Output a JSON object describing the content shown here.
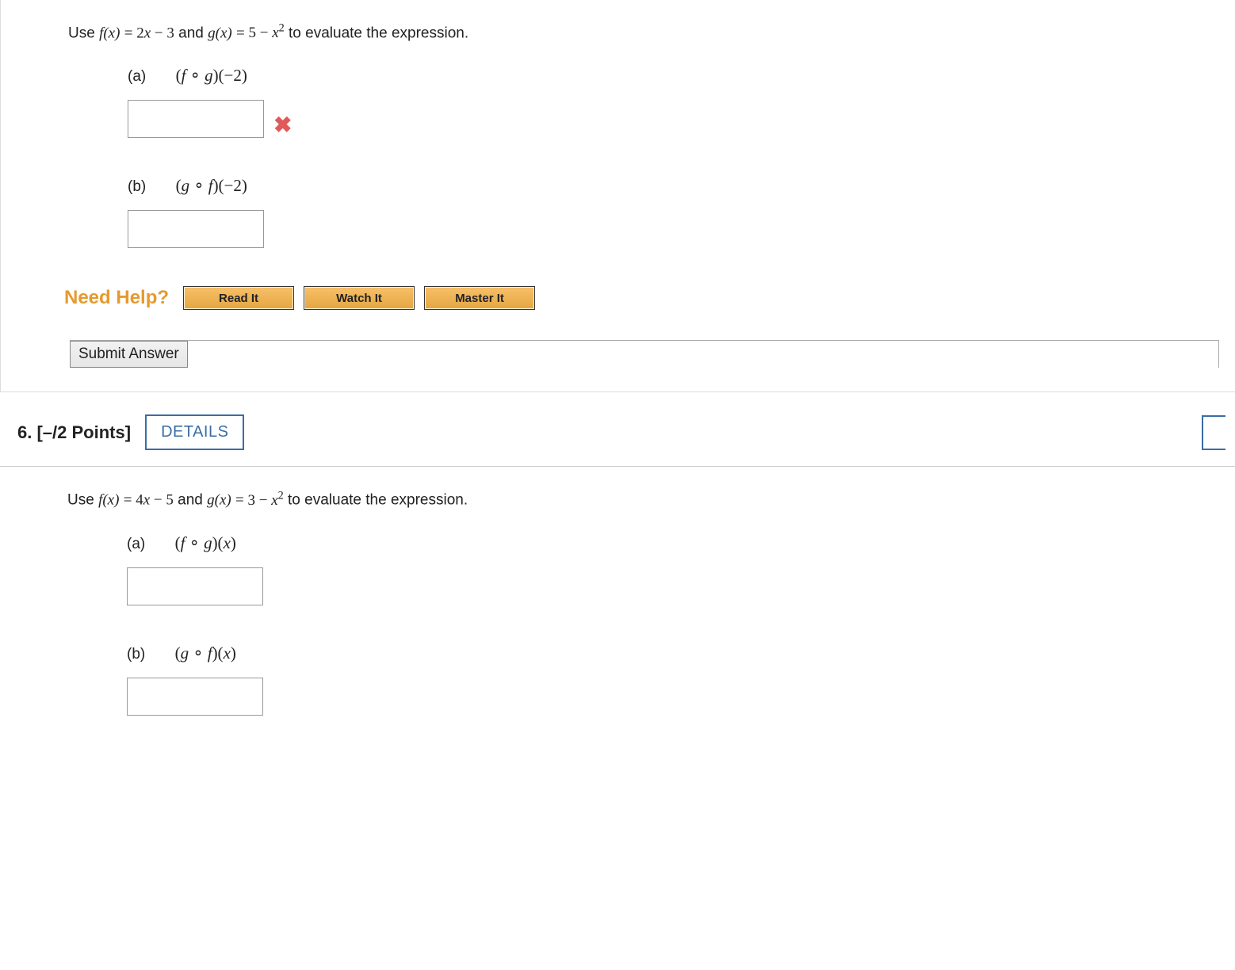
{
  "q5": {
    "prompt_pre": "Use  ",
    "f_def_lhs": "f(x)",
    "eq": " = ",
    "f_def_rhs": "2x − 3",
    "and": "  and  ",
    "g_def_lhs": "g(x)",
    "g_def_rhs_pre": "5 − ",
    "g_def_rhs_var": "x",
    "g_def_rhs_sup": "2",
    "prompt_post": "  to evaluate the expression.",
    "part_a_label": "(a)",
    "part_a_expr": "(f ∘ g)(−2)",
    "part_b_label": "(b)",
    "part_b_expr": "(g ∘ f)(−2)",
    "need_help": "Need Help?",
    "read_it": "Read It",
    "watch_it": "Watch It",
    "master_it": "Master It",
    "submit": "Submit Answer",
    "answer_a": "",
    "answer_b": ""
  },
  "q6": {
    "number": "6.",
    "points": "[–/2 Points]",
    "details": "DETAILS",
    "prompt_pre": "Use  ",
    "f_def_lhs": "f(x)",
    "eq": " = ",
    "f_def_rhs": "4x − 5",
    "and": "  and  ",
    "g_def_lhs": "g(x)",
    "g_def_rhs_pre": "3 − ",
    "g_def_rhs_var": "x",
    "g_def_rhs_sup": "2",
    "prompt_post": "  to evaluate the expression.",
    "part_a_label": "(a)",
    "part_a_expr": "(f ∘ g)(x)",
    "part_b_label": "(b)",
    "part_b_expr": "(g ∘ f)(x)",
    "answer_a": "",
    "answer_b": ""
  }
}
